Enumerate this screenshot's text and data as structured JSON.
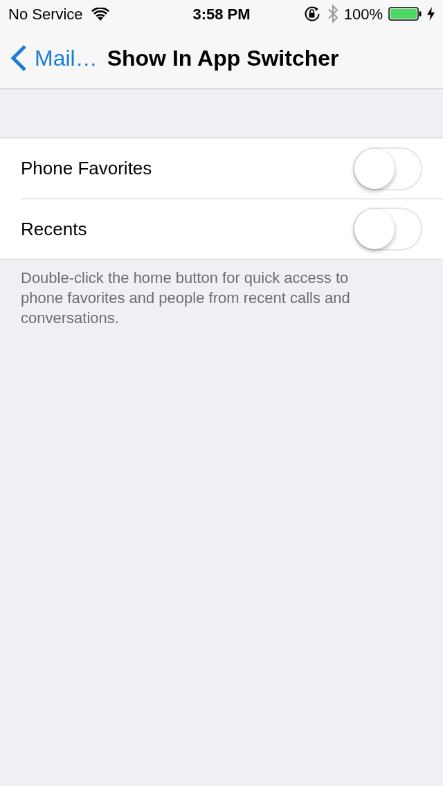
{
  "status_bar": {
    "carrier": "No Service",
    "time": "3:58 PM",
    "battery": "100%"
  },
  "nav_bar": {
    "back": "Mail…",
    "title": "Show In App Switcher"
  },
  "settings": [
    {
      "label": "Phone Favorites",
      "on": false
    },
    {
      "label": "Recents",
      "on": false
    }
  ],
  "footer": "Double-click the home button for quick access to phone favorites and people from recent calls and conversations."
}
